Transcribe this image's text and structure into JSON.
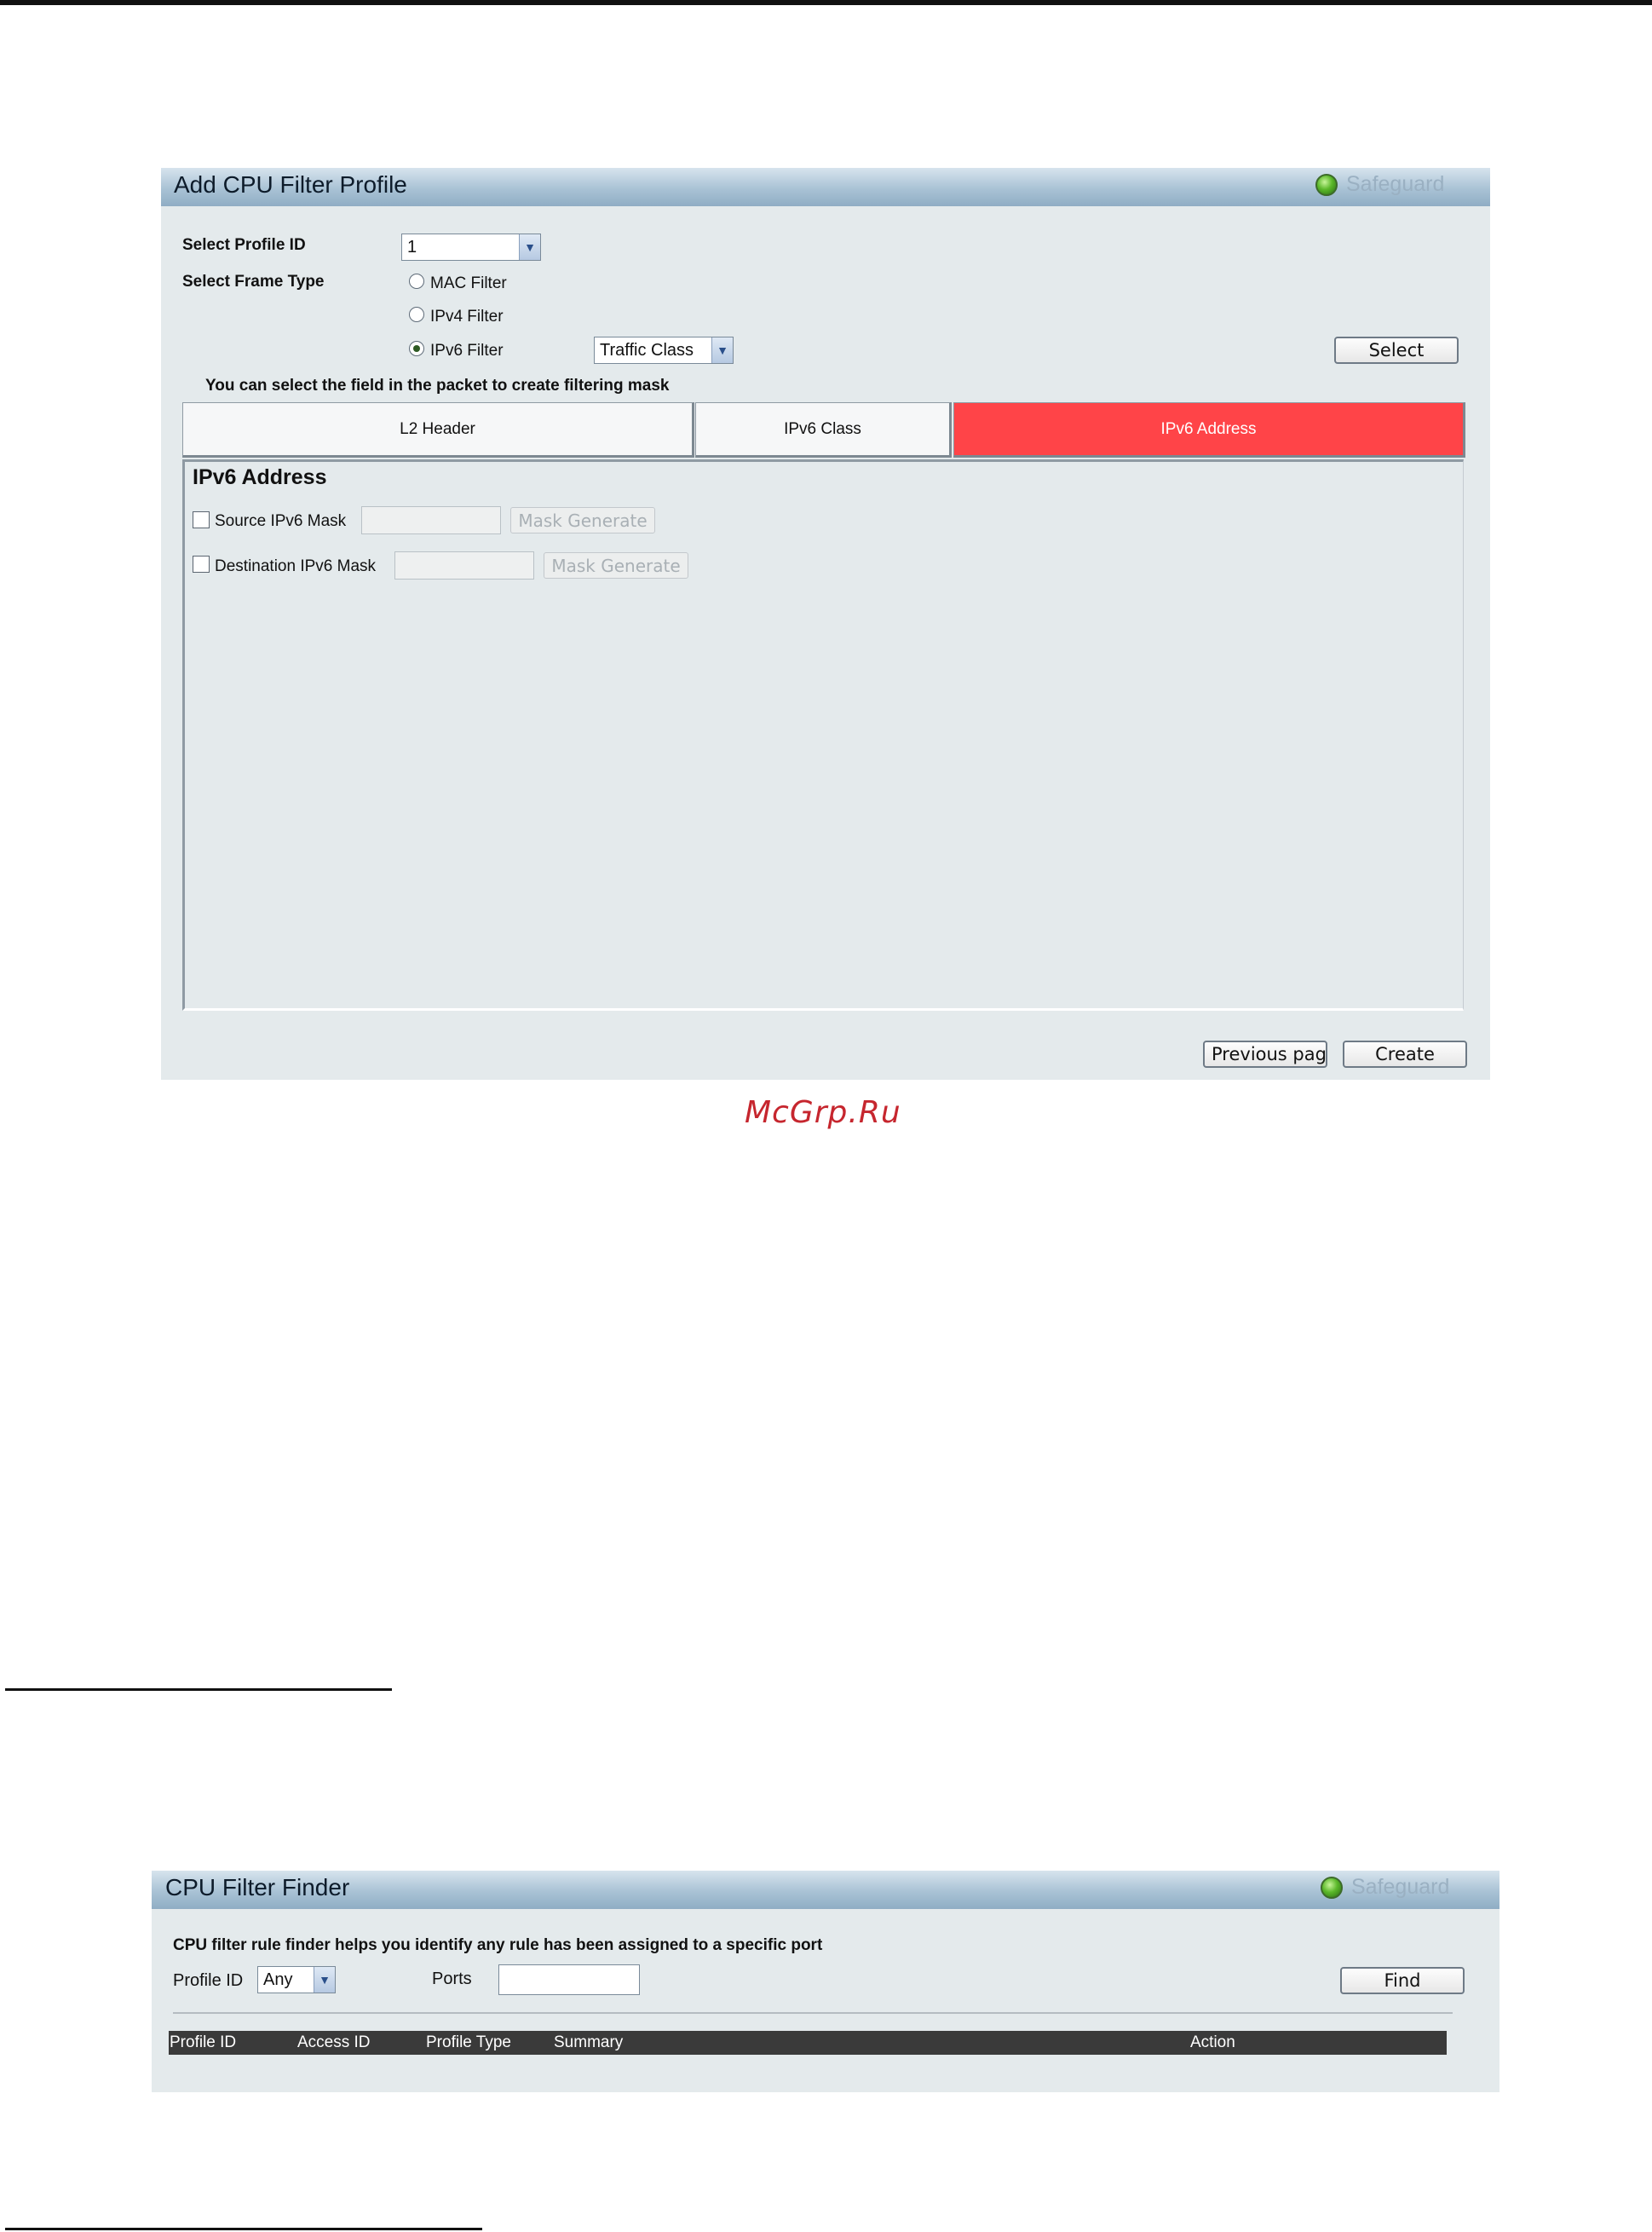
{
  "add_cpu_filter_profile": {
    "title": "Add CPU Filter Profile",
    "safeguard_label": "Safeguard",
    "profile_id_label": "Select Profile ID",
    "profile_id_value": "1",
    "frame_type_label": "Select Frame Type",
    "frame_types": [
      "MAC Filter",
      "IPv4 Filter",
      "IPv6 Filter"
    ],
    "selected_frame_type": "IPv6 Filter",
    "ipv6_field_select_value": "Traffic Class",
    "select_button": "Select",
    "instruction": "You can select the field in the packet to create filtering mask",
    "tabs": [
      {
        "label": "L2 Header",
        "active": false
      },
      {
        "label": "IPv6 Class",
        "active": false
      },
      {
        "label": "IPv6 Address",
        "active": true
      }
    ],
    "section_title": "IPv6 Address",
    "source_mask_label": "Source IPv6 Mask",
    "dest_mask_label": "Destination IPv6 Mask",
    "mask_generate_label": "Mask Generate",
    "previous_page_button": "Previous pag",
    "create_button": "Create"
  },
  "watermark": "McGrp.Ru",
  "cpu_filter_finder": {
    "title": "CPU Filter Finder",
    "safeguard_label": "Safeguard",
    "description": "CPU filter rule finder helps you identify any rule has been assigned to a specific port",
    "profile_id_label": "Profile ID",
    "profile_id_value": "Any",
    "ports_label": "Ports",
    "ports_value": "",
    "find_button": "Find",
    "columns": [
      "Profile ID",
      "Access ID",
      "Profile Type",
      "Summary",
      "Action"
    ]
  },
  "colors": {
    "active_tab": "#ff4448",
    "panel_body": "#e4eaec",
    "table_header": "#3a3a3a",
    "watermark": "#c6262e"
  }
}
